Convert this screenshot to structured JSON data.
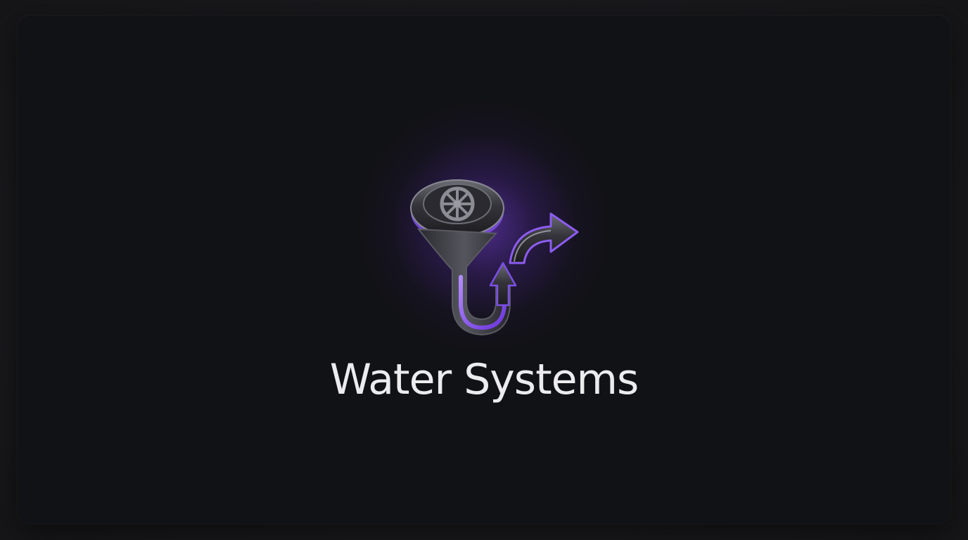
{
  "app": {
    "title": "Water Systems",
    "logo_icon": "drain-trap-arrow-icon",
    "accent_color": "#7c3aed",
    "background_color": "#111215"
  }
}
